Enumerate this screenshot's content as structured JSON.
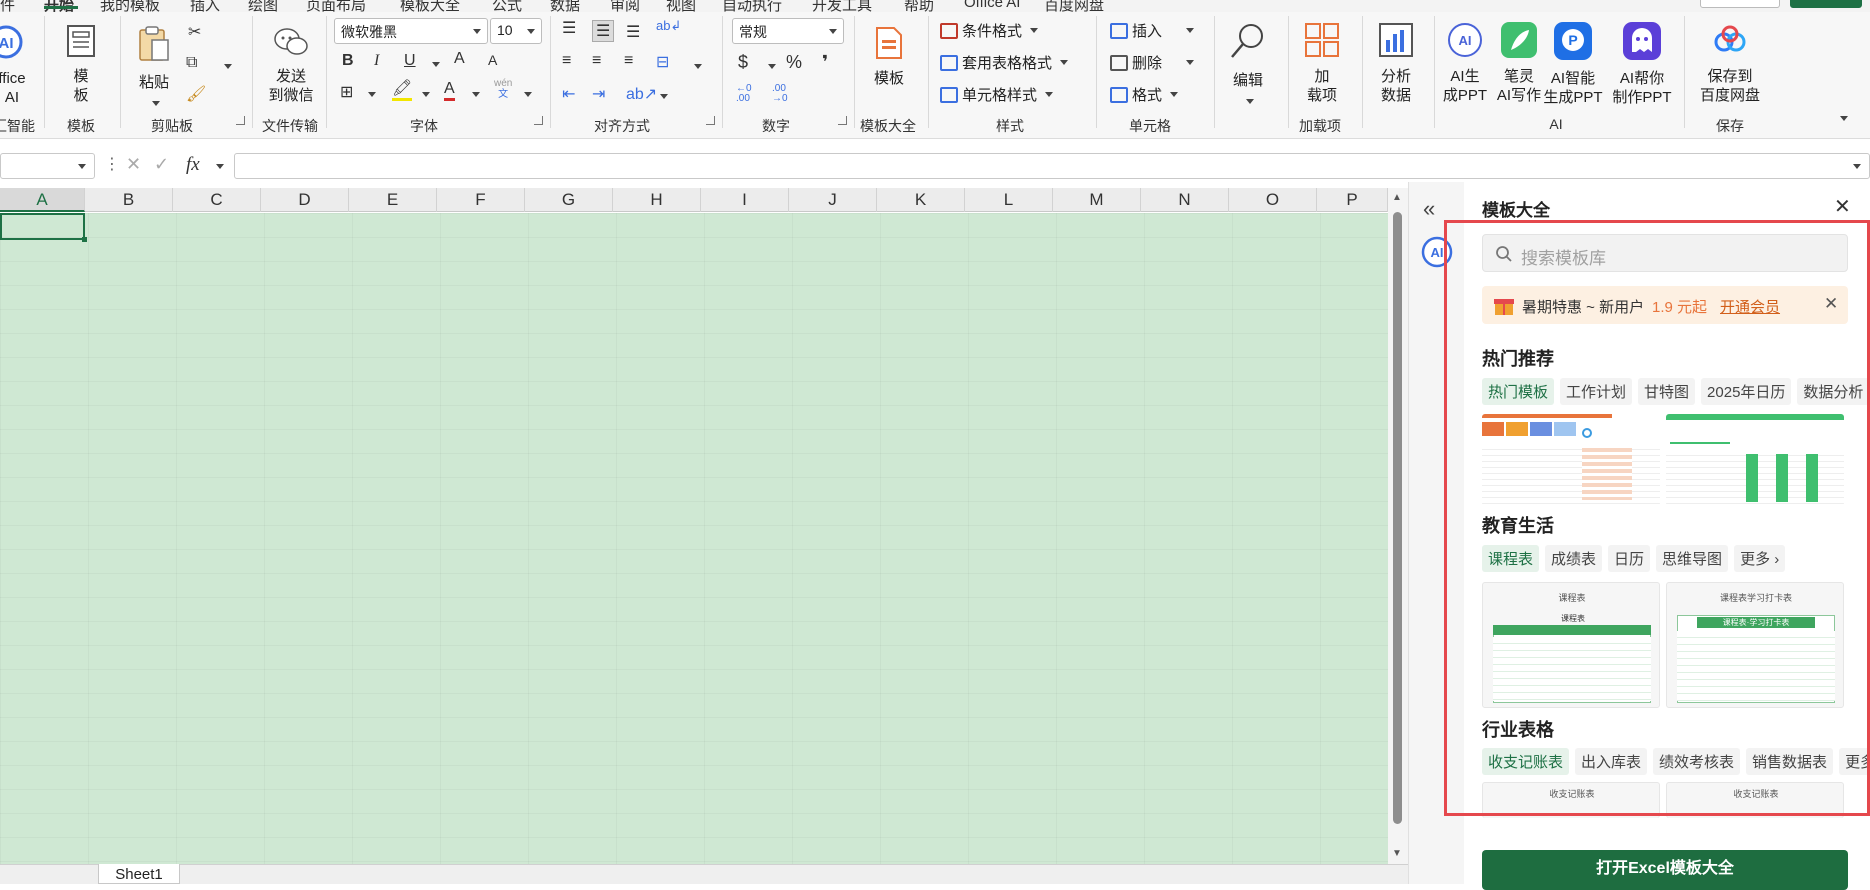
{
  "menubar": {
    "items": [
      "件",
      "开始",
      "我的模板",
      "插入",
      "绘图",
      "页面布局",
      "模板大全",
      "公式",
      "数据",
      "审阅",
      "视图",
      "自动执行",
      "开发工具",
      "帮助",
      "Office AI",
      "百度网盘"
    ],
    "active_index": 1
  },
  "ribbon": {
    "office_ai": {
      "line1": "ffice",
      "line2": "AI",
      "group": "汇智能"
    },
    "template": {
      "line1": "模",
      "line2": "板",
      "group": "模板"
    },
    "clipboard": {
      "paste": "粘贴",
      "group": "剪贴板"
    },
    "wechat": {
      "line1": "发送",
      "line2": "到微信",
      "group": "文件传输"
    },
    "font": {
      "name": "微软雅黑",
      "size": "10",
      "group": "字体",
      "bold": "B",
      "italic": "I",
      "underline": "U",
      "grow": "A",
      "shrink": "A",
      "color": "A",
      "phonetic_top": "wén",
      "phonetic_bottom": "文"
    },
    "alignment": {
      "group": "对齐方式"
    },
    "number": {
      "format": "常规",
      "group": "数字",
      "currency": "$",
      "percent": "%",
      "comma": "❜",
      "inc": "←0 .00",
      "dec": ".00 →0"
    },
    "template_all": {
      "label": "模板",
      "group": "模板大全"
    },
    "styles": {
      "cond": "条件格式",
      "table": "套用表格格式",
      "cell": "单元格样式",
      "group": "样式"
    },
    "cells": {
      "insert": "插入",
      "delete": "删除",
      "format": "格式",
      "group": "单元格"
    },
    "edit": {
      "label": "编辑"
    },
    "addins": {
      "line1": "加",
      "line2": "载项",
      "group": "加载项"
    },
    "analyze": {
      "line1": "分析",
      "line2": "数据"
    },
    "ai": {
      "ppt_line1": "AI生",
      "ppt_line2": "成PPT",
      "write_line1": "笔灵",
      "write_line2": "AI写作",
      "smart_line1": "AI智能",
      "smart_line2": "生成PPT",
      "help_line1": "AI帮你",
      "help_line2": "制作PPT",
      "group": "AI"
    },
    "save": {
      "line1": "保存到",
      "line2": "百度网盘",
      "group": "保存"
    }
  },
  "formula_bar": {
    "fx": "fx",
    "value": ""
  },
  "columns": [
    "A",
    "B",
    "C",
    "D",
    "E",
    "F",
    "G",
    "H",
    "I",
    "J",
    "K",
    "L",
    "M",
    "N",
    "O",
    "P"
  ],
  "sheet_tab": "Sheet1",
  "panel": {
    "title": "模板大全",
    "search_placeholder": "搜索模板库",
    "promo_text": "暑期特惠 ~ 新用户",
    "promo_price": "1.9 元起",
    "promo_link": "开通会员",
    "hot": {
      "title": "热门推荐",
      "chips": [
        "热门模板",
        "工作计划",
        "甘特图",
        "2025年日历",
        "数据分析"
      ]
    },
    "edu": {
      "title": "教育生活",
      "chips": [
        "课程表",
        "成绩表",
        "日历",
        "思维导图",
        "更多 ›"
      ],
      "thumb1_title": "课程表",
      "thumb1_inner": "课程表",
      "thumb2_title": "课程表学习打卡表",
      "thumb2_inner": "课程表·学习打卡表"
    },
    "industry": {
      "title": "行业表格",
      "chips": [
        "收支记账表",
        "出入库表",
        "绩效考核表",
        "销售数据表",
        "更多"
      ],
      "thumb1_title": "收支记账表",
      "thumb2_title": "收支记账表"
    },
    "open_button": "打开Excel模板大全"
  },
  "colors": {
    "accent": "#1e7145",
    "sheet_bg": "#cfe8d3",
    "highlight": "#e5484d"
  }
}
